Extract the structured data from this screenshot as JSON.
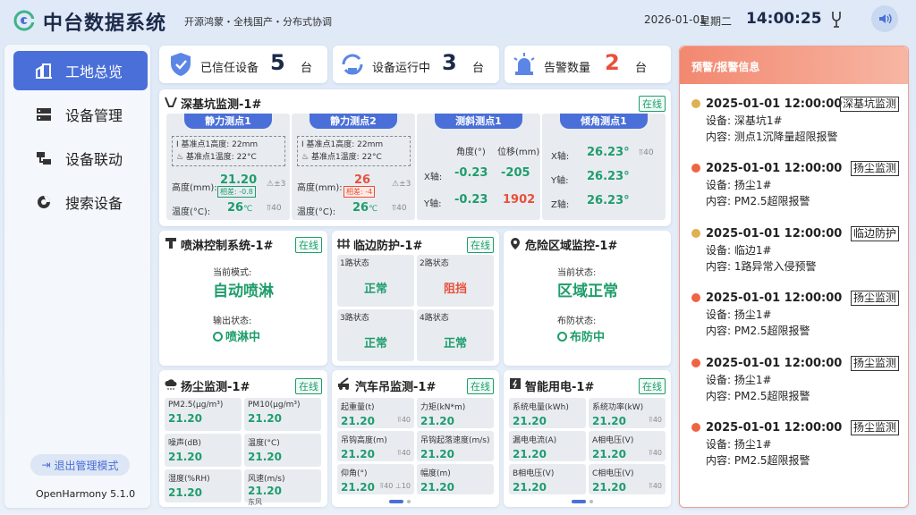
{
  "header": {
    "title": "中台数据系统",
    "subtitle": "开源鸿蒙・全栈国产・分布式协调",
    "date": "2026-01-01",
    "weekday": "星期二",
    "time": "14:00:25"
  },
  "sidebar": {
    "items": [
      {
        "label": "工地总览",
        "active": true
      },
      {
        "label": "设备管理"
      },
      {
        "label": "设备联动"
      },
      {
        "label": "搜索设备"
      }
    ],
    "logout": "退出管理模式",
    "version": "OpenHarmony 5.1.0"
  },
  "stats": [
    {
      "label": "已信任设备",
      "value": "5",
      "unit": "台"
    },
    {
      "label": "设备运行中",
      "value": "3",
      "unit": "台"
    },
    {
      "label": "告警数量",
      "value": "2",
      "unit": "台"
    }
  ],
  "pit": {
    "title": "深基坑监测-1#",
    "status": "在线",
    "s1": {
      "title": "静力测点1",
      "ref_height": "基准点1高度: 22mm",
      "ref_temp": "基准点1温度: 22°C",
      "height_label": "高度(mm):",
      "height_val": "21.20",
      "diff": "相差: -0.8",
      "warn": "±3",
      "temp_label": "温度(°C):",
      "temp_val": "26",
      "temp_unit": "℃",
      "signal": "40"
    },
    "s2": {
      "title": "静力测点2",
      "ref_height": "基准点1高度: 22mm",
      "ref_temp": "基准点1温度: 22°C",
      "height_label": "高度(mm):",
      "height_val": "26",
      "diff": "相差: -4",
      "warn": "±3",
      "temp_label": "温度(°C):",
      "temp_val": "26",
      "temp_unit": "℃",
      "signal": "40"
    },
    "incl": {
      "title": "测斜测点1",
      "angle_head": "角度(°)",
      "disp_head": "位移(mm)",
      "x_label": "X轴:",
      "x_angle": "-0.23",
      "x_disp": "-205",
      "y_label": "Y轴:",
      "y_angle": "-0.23",
      "y_disp": "1902"
    },
    "tilt": {
      "title": "倾角测点1",
      "x_label": "X轴:",
      "x_val": "26.23°",
      "y_label": "Y轴:",
      "y_val": "26.23°",
      "z_label": "Z轴:",
      "z_val": "26.23°",
      "signal": "40"
    }
  },
  "spray": {
    "title": "喷淋控制系统-1#",
    "status": "在线",
    "mode_label": "当前模式:",
    "mode": "自动喷淋",
    "out_label": "输出状态:",
    "out": "喷淋中"
  },
  "edge": {
    "title": "临边防护-1#",
    "status": "在线",
    "ch": [
      {
        "label": "1路状态",
        "value": "正常"
      },
      {
        "label": "2路状态",
        "value": "阻挡"
      },
      {
        "label": "3路状态",
        "value": "正常"
      },
      {
        "label": "4路状态",
        "value": "正常"
      }
    ]
  },
  "danger": {
    "title": "危险区域监控-1#",
    "status": "在线",
    "state_label": "当前状态:",
    "state": "区域正常",
    "arm_label": "布防状态:",
    "arm": "布防中"
  },
  "dust": {
    "title": "扬尘监测-1#",
    "status": "在线",
    "cells": [
      {
        "label": "PM2.5(μg/m³)",
        "value": "21.20"
      },
      {
        "label": "PM10(μg/m³)",
        "value": "21.20"
      },
      {
        "label": "噪声(dB)",
        "value": "21.20"
      },
      {
        "label": "温度(°C)",
        "value": "21.20"
      },
      {
        "label": "湿度(%RH)",
        "value": "21.20"
      },
      {
        "label": "风速(m/s)",
        "value": "21.20",
        "extra": "东风"
      }
    ]
  },
  "crane": {
    "title": "汽车吊监测-1#",
    "status": "在线",
    "cells": [
      {
        "label": "起重量(t)",
        "value": "21.20",
        "sig": "40"
      },
      {
        "label": "力矩(kN*m)",
        "value": "21.20"
      },
      {
        "label": "吊钩高度(m)",
        "value": "21.20",
        "sig": "40"
      },
      {
        "label": "吊钩起落速度(m/s)",
        "value": "21.20"
      },
      {
        "label": "仰角(°)",
        "value": "21.20",
        "sig": "40",
        "sig2": "10"
      },
      {
        "label": "幅度(m)",
        "value": "21.20"
      }
    ]
  },
  "power": {
    "title": "智能用电-1#",
    "status": "在线",
    "cells": [
      {
        "label": "系统电量(kWh)",
        "value": "21.20"
      },
      {
        "label": "系统功率(kW)",
        "value": "21.20",
        "sig": "40"
      },
      {
        "label": "漏电电流(A)",
        "value": "21.20"
      },
      {
        "label": "A相电压(V)",
        "value": "21.20",
        "sig": "40"
      },
      {
        "label": "B相电压(V)",
        "value": "21.20"
      },
      {
        "label": "C相电压(V)",
        "value": "21.20",
        "sig": "40"
      }
    ]
  },
  "alarms": {
    "title": "预警/报警信息",
    "items": [
      {
        "time": "2025-01-01 12:00:00",
        "tag": "深基坑监测",
        "device": "设备: 深基坑1#",
        "content": "内容: 测点1沉降量超限报警",
        "color": "#e0b050"
      },
      {
        "time": "2025-01-01 12:00:00",
        "tag": "扬尘监测",
        "device": "设备: 扬尘1#",
        "content": "内容: PM2.5超限报警",
        "color": "#ef6445"
      },
      {
        "time": "2025-01-01 12:00:00",
        "tag": "临边防护",
        "device": "设备: 临边1#",
        "content": "内容: 1路异常入侵预警",
        "color": "#e0b050"
      },
      {
        "time": "2025-01-01 12:00:00",
        "tag": "扬尘监测",
        "device": "设备: 扬尘1#",
        "content": "内容: PM2.5超限报警",
        "color": "#ef6445"
      },
      {
        "time": "2025-01-01 12:00:00",
        "tag": "扬尘监测",
        "device": "设备: 扬尘1#",
        "content": "内容: PM2.5超限报警",
        "color": "#ef6445"
      },
      {
        "time": "2025-01-01 12:00:00",
        "tag": "扬尘监测",
        "device": "设备: 扬尘1#",
        "content": "内容: PM2.5超限报警",
        "color": "#ef6445"
      }
    ]
  },
  "colors": {
    "accent": "#4a6fd8",
    "online": "#1f9d6b",
    "alert": "#e8503a",
    "alarm_header": "#f28870"
  }
}
